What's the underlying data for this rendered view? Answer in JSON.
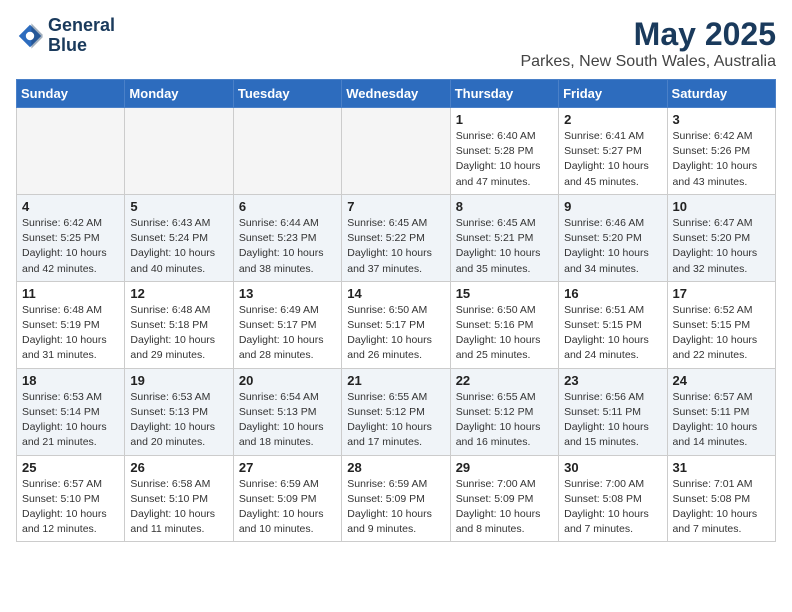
{
  "logo": {
    "line1": "General",
    "line2": "Blue"
  },
  "title": "May 2025",
  "location": "Parkes, New South Wales, Australia",
  "weekdays": [
    "Sunday",
    "Monday",
    "Tuesday",
    "Wednesday",
    "Thursday",
    "Friday",
    "Saturday"
  ],
  "weeks": [
    [
      {
        "day": "",
        "info": ""
      },
      {
        "day": "",
        "info": ""
      },
      {
        "day": "",
        "info": ""
      },
      {
        "day": "",
        "info": ""
      },
      {
        "day": "1",
        "info": "Sunrise: 6:40 AM\nSunset: 5:28 PM\nDaylight: 10 hours\nand 47 minutes."
      },
      {
        "day": "2",
        "info": "Sunrise: 6:41 AM\nSunset: 5:27 PM\nDaylight: 10 hours\nand 45 minutes."
      },
      {
        "day": "3",
        "info": "Sunrise: 6:42 AM\nSunset: 5:26 PM\nDaylight: 10 hours\nand 43 minutes."
      }
    ],
    [
      {
        "day": "4",
        "info": "Sunrise: 6:42 AM\nSunset: 5:25 PM\nDaylight: 10 hours\nand 42 minutes."
      },
      {
        "day": "5",
        "info": "Sunrise: 6:43 AM\nSunset: 5:24 PM\nDaylight: 10 hours\nand 40 minutes."
      },
      {
        "day": "6",
        "info": "Sunrise: 6:44 AM\nSunset: 5:23 PM\nDaylight: 10 hours\nand 38 minutes."
      },
      {
        "day": "7",
        "info": "Sunrise: 6:45 AM\nSunset: 5:22 PM\nDaylight: 10 hours\nand 37 minutes."
      },
      {
        "day": "8",
        "info": "Sunrise: 6:45 AM\nSunset: 5:21 PM\nDaylight: 10 hours\nand 35 minutes."
      },
      {
        "day": "9",
        "info": "Sunrise: 6:46 AM\nSunset: 5:20 PM\nDaylight: 10 hours\nand 34 minutes."
      },
      {
        "day": "10",
        "info": "Sunrise: 6:47 AM\nSunset: 5:20 PM\nDaylight: 10 hours\nand 32 minutes."
      }
    ],
    [
      {
        "day": "11",
        "info": "Sunrise: 6:48 AM\nSunset: 5:19 PM\nDaylight: 10 hours\nand 31 minutes."
      },
      {
        "day": "12",
        "info": "Sunrise: 6:48 AM\nSunset: 5:18 PM\nDaylight: 10 hours\nand 29 minutes."
      },
      {
        "day": "13",
        "info": "Sunrise: 6:49 AM\nSunset: 5:17 PM\nDaylight: 10 hours\nand 28 minutes."
      },
      {
        "day": "14",
        "info": "Sunrise: 6:50 AM\nSunset: 5:17 PM\nDaylight: 10 hours\nand 26 minutes."
      },
      {
        "day": "15",
        "info": "Sunrise: 6:50 AM\nSunset: 5:16 PM\nDaylight: 10 hours\nand 25 minutes."
      },
      {
        "day": "16",
        "info": "Sunrise: 6:51 AM\nSunset: 5:15 PM\nDaylight: 10 hours\nand 24 minutes."
      },
      {
        "day": "17",
        "info": "Sunrise: 6:52 AM\nSunset: 5:15 PM\nDaylight: 10 hours\nand 22 minutes."
      }
    ],
    [
      {
        "day": "18",
        "info": "Sunrise: 6:53 AM\nSunset: 5:14 PM\nDaylight: 10 hours\nand 21 minutes."
      },
      {
        "day": "19",
        "info": "Sunrise: 6:53 AM\nSunset: 5:13 PM\nDaylight: 10 hours\nand 20 minutes."
      },
      {
        "day": "20",
        "info": "Sunrise: 6:54 AM\nSunset: 5:13 PM\nDaylight: 10 hours\nand 18 minutes."
      },
      {
        "day": "21",
        "info": "Sunrise: 6:55 AM\nSunset: 5:12 PM\nDaylight: 10 hours\nand 17 minutes."
      },
      {
        "day": "22",
        "info": "Sunrise: 6:55 AM\nSunset: 5:12 PM\nDaylight: 10 hours\nand 16 minutes."
      },
      {
        "day": "23",
        "info": "Sunrise: 6:56 AM\nSunset: 5:11 PM\nDaylight: 10 hours\nand 15 minutes."
      },
      {
        "day": "24",
        "info": "Sunrise: 6:57 AM\nSunset: 5:11 PM\nDaylight: 10 hours\nand 14 minutes."
      }
    ],
    [
      {
        "day": "25",
        "info": "Sunrise: 6:57 AM\nSunset: 5:10 PM\nDaylight: 10 hours\nand 12 minutes."
      },
      {
        "day": "26",
        "info": "Sunrise: 6:58 AM\nSunset: 5:10 PM\nDaylight: 10 hours\nand 11 minutes."
      },
      {
        "day": "27",
        "info": "Sunrise: 6:59 AM\nSunset: 5:09 PM\nDaylight: 10 hours\nand 10 minutes."
      },
      {
        "day": "28",
        "info": "Sunrise: 6:59 AM\nSunset: 5:09 PM\nDaylight: 10 hours\nand 9 minutes."
      },
      {
        "day": "29",
        "info": "Sunrise: 7:00 AM\nSunset: 5:09 PM\nDaylight: 10 hours\nand 8 minutes."
      },
      {
        "day": "30",
        "info": "Sunrise: 7:00 AM\nSunset: 5:08 PM\nDaylight: 10 hours\nand 7 minutes."
      },
      {
        "day": "31",
        "info": "Sunrise: 7:01 AM\nSunset: 5:08 PM\nDaylight: 10 hours\nand 7 minutes."
      }
    ]
  ]
}
